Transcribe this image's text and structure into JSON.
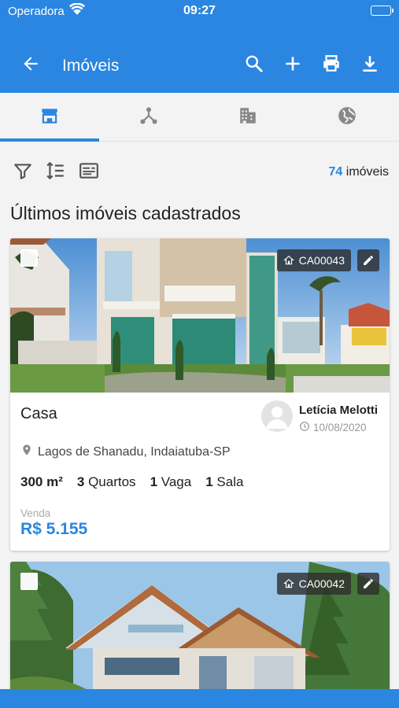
{
  "status_bar": {
    "carrier": "Operadora",
    "time": "09:27"
  },
  "app_bar": {
    "title": "Imóveis",
    "icons": [
      "arrow-back-icon",
      "search-icon",
      "plus-icon",
      "print-icon",
      "download-icon"
    ]
  },
  "tabs": [
    {
      "icon": "storefront-icon",
      "selected": true
    },
    {
      "icon": "hub-icon",
      "selected": false
    },
    {
      "icon": "building-icon",
      "selected": false
    },
    {
      "icon": "globe-icon",
      "selected": false
    }
  ],
  "toolbar": {
    "icons": [
      "filter-icon",
      "sort-icon",
      "card-view-icon"
    ],
    "count_number": "74",
    "count_label": "imóveis"
  },
  "section_title": "Últimos imóveis cadastrados",
  "listings": [
    {
      "code": "CA00043",
      "type": "Casa",
      "agent_name": "Letícia Melotti",
      "agent_date": "10/08/2020",
      "location": "Lagos de Shanadu, Indaiatuba-SP",
      "features": [
        {
          "value": "300 m²",
          "label": ""
        },
        {
          "value": "3",
          "label": "Quartos"
        },
        {
          "value": "1",
          "label": "Vaga"
        },
        {
          "value": "1",
          "label": "Sala"
        }
      ],
      "deal_type": "Venda",
      "price": "R$ 5.155"
    },
    {
      "code": "CA00042"
    }
  ],
  "colors": {
    "primary": "#2a86e0",
    "background": "#f3f3f3",
    "text": "#222222"
  }
}
